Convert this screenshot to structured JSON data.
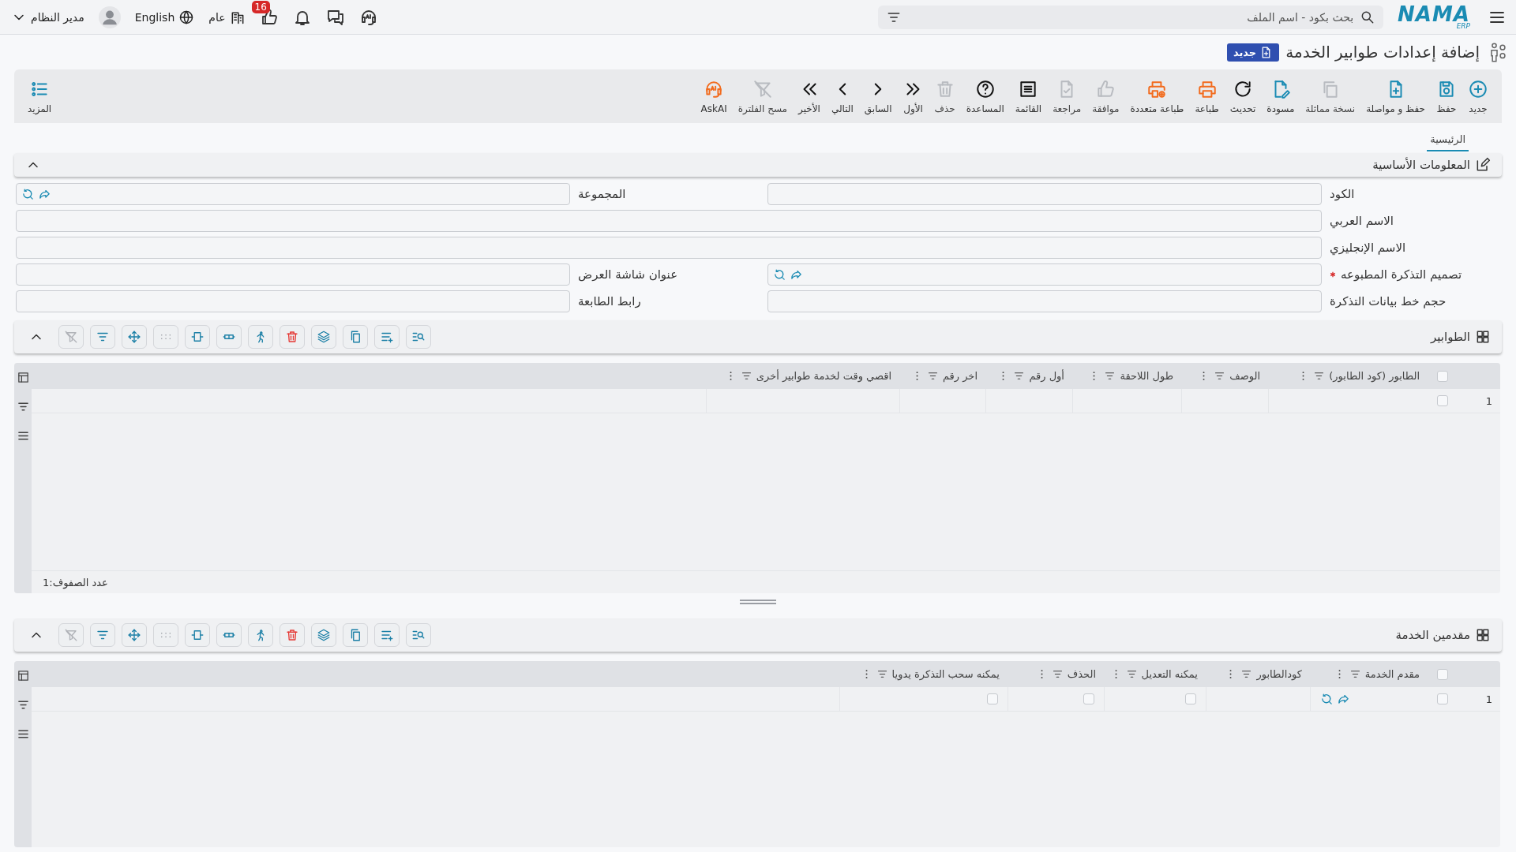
{
  "topbar": {
    "logo": {
      "name": "NAMA",
      "sub": "ERP"
    },
    "search": {
      "placeholder": "بحث بكود - اسم الملف"
    },
    "user": "مدير النظام",
    "language": "English",
    "branch": "عام",
    "badge": "16"
  },
  "page": {
    "title": "إضافة إعدادات طوابير الخدمة",
    "status": "جديد"
  },
  "toolbar": [
    {
      "label": "جديد",
      "kind": "new",
      "disabled": false
    },
    {
      "label": "حفظ",
      "kind": "save",
      "disabled": false
    },
    {
      "label": "حفظ و مواصلة",
      "kind": "save_continue",
      "disabled": false
    },
    {
      "label": "نسخة مماثلة",
      "kind": "duplicate",
      "disabled": true
    },
    {
      "label": "مسودة",
      "kind": "draft",
      "disabled": false
    },
    {
      "label": "تحديث",
      "kind": "refresh",
      "disabled": false
    },
    {
      "label": "طباعة",
      "kind": "print",
      "disabled": false
    },
    {
      "label": "طباعة متعددة",
      "kind": "multi_print",
      "disabled": false
    },
    {
      "label": "موافقة",
      "kind": "approve",
      "disabled": true
    },
    {
      "label": "مراجعة",
      "kind": "review",
      "disabled": true
    },
    {
      "label": "القائمة",
      "kind": "list",
      "disabled": false
    },
    {
      "label": "المساعدة",
      "kind": "help",
      "disabled": false
    },
    {
      "label": "حذف",
      "kind": "delete",
      "disabled": true
    },
    {
      "label": "الأول",
      "kind": "first",
      "disabled": false
    },
    {
      "label": "السابق",
      "kind": "previous",
      "disabled": false
    },
    {
      "label": "التالي",
      "kind": "next",
      "disabled": false
    },
    {
      "label": "الأخير",
      "kind": "last",
      "disabled": false
    },
    {
      "label": "مسح الفلترة",
      "kind": "clear_filter",
      "disabled": true
    },
    {
      "label": "AskAI",
      "kind": "ask_ai",
      "disabled": false
    }
  ],
  "more": {
    "label": "المزيد"
  },
  "tabs": [
    {
      "label": "الرئيسية",
      "selected": true
    }
  ],
  "form": {
    "title": "المعلومات الأساسية",
    "expanded": true,
    "rows": [
      [
        {
          "label": "الكود",
          "kind": "text",
          "required": false
        },
        {
          "label": "المجموعة",
          "kind": "lookup",
          "required": false
        }
      ],
      [
        {
          "label": "الاسم العربي",
          "kind": "text",
          "required": false
        }
      ],
      [
        {
          "label": "الاسم الإنجليزي",
          "kind": "text",
          "required": false
        }
      ],
      [
        {
          "label": "تصميم التذكرة المطبوعه",
          "kind": "lookup",
          "required": true
        },
        {
          "label": "عنوان شاشة العرض",
          "kind": "text",
          "required": false
        }
      ],
      [
        {
          "label": "حجم خط بيانات التذكرة",
          "kind": "text",
          "required": false
        },
        {
          "label": "رابط الطابعة",
          "kind": "text",
          "required": false
        }
      ]
    ]
  },
  "grids": [
    {
      "title": "الطوابير",
      "expanded": true,
      "tools": [
        {
          "kind": "find",
          "disabled": false
        },
        {
          "kind": "add_lines",
          "disabled": false
        },
        {
          "kind": "copy",
          "disabled": false
        },
        {
          "kind": "layers",
          "disabled": false
        },
        {
          "kind": "delete",
          "disabled": false
        },
        {
          "kind": "run",
          "disabled": false
        },
        {
          "kind": "rows",
          "disabled": false
        },
        {
          "kind": "fit",
          "disabled": false
        },
        {
          "kind": "dots",
          "disabled": false
        },
        {
          "kind": "move",
          "disabled": false
        },
        {
          "kind": "filter",
          "disabled": false
        },
        {
          "kind": "clear_filter",
          "disabled": true
        }
      ],
      "all_checked": false,
      "columns": [
        {
          "label": "الطابور (كود الطابور)"
        },
        {
          "label": "الوصف"
        },
        {
          "label": "طول اللاحقة"
        },
        {
          "label": "أول رقم"
        },
        {
          "label": "اخر رقم"
        },
        {
          "label": "اقصي وقت لخدمة طوابير أخرى"
        }
      ],
      "rows": [
        {
          "number": "1",
          "checked": false,
          "cells": [
            {
              "kind": "empty"
            },
            {
              "kind": "empty"
            },
            {
              "kind": "empty"
            },
            {
              "kind": "empty"
            },
            {
              "kind": "empty"
            },
            {
              "kind": "empty"
            }
          ]
        }
      ],
      "row_count": "عدد الصفوف:1"
    },
    {
      "title": "مقدمين الخدمة",
      "expanded": true,
      "tools": [
        {
          "kind": "find",
          "disabled": false
        },
        {
          "kind": "add_lines",
          "disabled": false
        },
        {
          "kind": "copy",
          "disabled": false
        },
        {
          "kind": "layers",
          "disabled": false
        },
        {
          "kind": "delete",
          "disabled": false
        },
        {
          "kind": "run",
          "disabled": false
        },
        {
          "kind": "rows",
          "disabled": false
        },
        {
          "kind": "fit",
          "disabled": false
        },
        {
          "kind": "dots",
          "disabled": false
        },
        {
          "kind": "move",
          "disabled": false
        },
        {
          "kind": "filter",
          "disabled": false
        },
        {
          "kind": "clear_filter",
          "disabled": true
        }
      ],
      "all_checked": false,
      "columns": [
        {
          "label": "مقدم الخدمة"
        },
        {
          "label": "كودالطابور"
        },
        {
          "label": "يمكنه التعديل"
        },
        {
          "label": "الحذف"
        },
        {
          "label": "يمكنه سحب التذكرة يدويا"
        }
      ],
      "rows": [
        {
          "number": "1",
          "checked": false,
          "cells": [
            {
              "kind": "lookup"
            },
            {
              "kind": "empty"
            },
            {
              "kind": "check",
              "checked": false
            },
            {
              "kind": "check",
              "checked": false
            },
            {
              "kind": "check",
              "checked": false
            }
          ]
        }
      ]
    }
  ]
}
